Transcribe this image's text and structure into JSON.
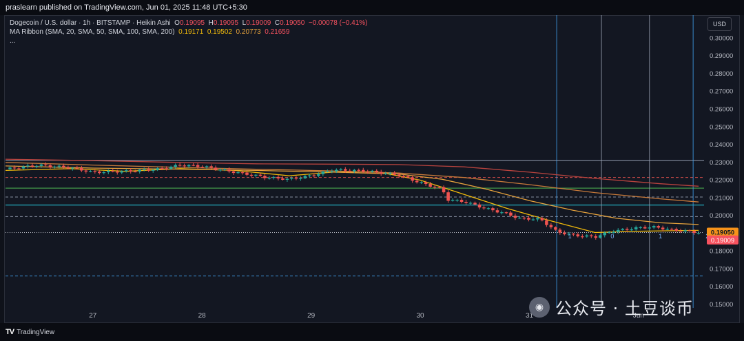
{
  "header": {
    "published": "praslearn published on TradingView.com, Jun 01, 2025 11:48 UTC+5:30"
  },
  "legend": {
    "symbol": "Dogecoin / U.S. dollar · 1h · BITSTAMP · Heikin Ashi",
    "o_label": "O",
    "o": "0.19095",
    "h_label": "H",
    "h": "0.19095",
    "l_label": "L",
    "l": "0.19009",
    "c_label": "C",
    "c": "0.19050",
    "change": "−0.00078 (−0.41%)",
    "ma_name": "MA Ribbon (SMA, 20, SMA, 50, SMA, 100, SMA, 200)",
    "ma1": "0.19171",
    "ma2": "0.19502",
    "ma3": "0.20773",
    "ma4": "0.21659",
    "more": "..."
  },
  "currency": "USD",
  "price_labels": {
    "last": "0.19050",
    "countdown": "41:41",
    "low": "0.19009"
  },
  "footer": {
    "brand": "TradingView"
  },
  "watermark": {
    "text": "公众号 · 土豆谈币"
  },
  "colors": {
    "up": "#26a69a",
    "down": "#ef5350",
    "ma20": "#f0b90b",
    "ma50": "#e6a23c",
    "ma100": "#c87a3a",
    "ma200": "#b8433e",
    "background": "#131722"
  },
  "chart_data": {
    "type": "candlestick",
    "title": "Dogecoin / U.S. dollar · 1h · BITSTAMP · Heikin Ashi",
    "x_labels": [
      "27",
      "28",
      "29",
      "30",
      "31",
      "Jun"
    ],
    "y_ticks": [
      "0.30000",
      "0.29000",
      "0.28000",
      "0.27000",
      "0.26000",
      "0.25000",
      "0.24000",
      "0.23000",
      "0.22000",
      "0.21000",
      "0.20000",
      "0.18000",
      "0.17000",
      "0.16000",
      "0.15000"
    ],
    "ylim": [
      0.148,
      0.306
    ],
    "x_range": [
      26.2,
      32.6
    ],
    "horizontal_levels": [
      {
        "value": 0.2312,
        "style": "solid",
        "color": "#9aa3b5"
      },
      {
        "value": 0.2215,
        "style": "dashed",
        "color": "#ef5350"
      },
      {
        "value": 0.2155,
        "style": "solid",
        "color": "#4caf50"
      },
      {
        "value": 0.2105,
        "style": "dashed",
        "color": "#9aa3b5"
      },
      {
        "value": 0.206,
        "style": "solid",
        "color": "#26c6da"
      },
      {
        "value": 0.1995,
        "style": "dashed",
        "color": "#9aa3b5"
      },
      {
        "value": 0.1905,
        "style": "dotted",
        "color": "#d1d4dc"
      },
      {
        "value": 0.166,
        "style": "dashed",
        "color": "#42a5f5"
      }
    ],
    "vertical_lines": [
      {
        "x": 31.25,
        "color": "#42a5f5"
      },
      {
        "x": 31.66,
        "color": "#9aa3b5"
      },
      {
        "x": 32.1,
        "color": "#9aa3b5"
      },
      {
        "x": 32.5,
        "color": "#42a5f5"
      }
    ],
    "wave_labels": [
      {
        "x": 31.37,
        "y": 0.1872,
        "text": "1"
      },
      {
        "x": 31.76,
        "y": 0.1872,
        "text": "0"
      },
      {
        "x": 32.2,
        "y": 0.1872,
        "text": "1"
      },
      {
        "x": 32.63,
        "y": 0.1872,
        "text": "2"
      }
    ],
    "anchors": [
      [
        26.2,
        0.2262
      ],
      [
        26.5,
        0.2285
      ],
      [
        26.8,
        0.227
      ],
      [
        27.0,
        0.2245
      ],
      [
        27.3,
        0.225
      ],
      [
        27.6,
        0.2262
      ],
      [
        27.8,
        0.2285
      ],
      [
        28.0,
        0.2278
      ],
      [
        28.3,
        0.2245
      ],
      [
        28.6,
        0.2215
      ],
      [
        28.8,
        0.2205
      ],
      [
        29.0,
        0.2225
      ],
      [
        29.2,
        0.2258
      ],
      [
        29.5,
        0.2252
      ],
      [
        29.8,
        0.223
      ],
      [
        30.0,
        0.2185
      ],
      [
        30.2,
        0.215
      ],
      [
        30.25,
        0.209
      ],
      [
        30.4,
        0.208
      ],
      [
        30.6,
        0.204
      ],
      [
        30.8,
        0.201
      ],
      [
        30.9,
        0.1985
      ],
      [
        31.1,
        0.198
      ],
      [
        31.25,
        0.191
      ],
      [
        31.4,
        0.189
      ],
      [
        31.6,
        0.188
      ],
      [
        31.75,
        0.1912
      ],
      [
        32.0,
        0.1932
      ],
      [
        32.15,
        0.1936
      ],
      [
        32.3,
        0.192
      ],
      [
        32.45,
        0.1912
      ],
      [
        32.55,
        0.1905
      ]
    ],
    "series": [
      {
        "name": "SMA 20",
        "color": "#f0b90b",
        "points": [
          [
            26.2,
            0.2255
          ],
          [
            26.8,
            0.2265
          ],
          [
            27.3,
            0.225
          ],
          [
            27.8,
            0.2265
          ],
          [
            28.3,
            0.2255
          ],
          [
            28.8,
            0.2225
          ],
          [
            29.2,
            0.2245
          ],
          [
            29.6,
            0.2248
          ],
          [
            30.0,
            0.22
          ],
          [
            30.4,
            0.212
          ],
          [
            30.8,
            0.204
          ],
          [
            31.2,
            0.197
          ],
          [
            31.6,
            0.1905
          ],
          [
            32.0,
            0.1912
          ],
          [
            32.4,
            0.1916
          ],
          [
            32.55,
            0.1917
          ]
        ]
      },
      {
        "name": "SMA 50",
        "color": "#e6a23c",
        "points": [
          [
            26.2,
            0.228
          ],
          [
            27.0,
            0.2268
          ],
          [
            27.8,
            0.2262
          ],
          [
            28.5,
            0.2255
          ],
          [
            29.2,
            0.2245
          ],
          [
            29.8,
            0.2235
          ],
          [
            30.2,
            0.2205
          ],
          [
            30.6,
            0.215
          ],
          [
            31.0,
            0.2085
          ],
          [
            31.4,
            0.203
          ],
          [
            31.8,
            0.1985
          ],
          [
            32.2,
            0.196
          ],
          [
            32.55,
            0.195
          ]
        ]
      },
      {
        "name": "SMA 100",
        "color": "#c87a3a",
        "points": [
          [
            26.2,
            0.23
          ],
          [
            27.0,
            0.2285
          ],
          [
            27.8,
            0.2272
          ],
          [
            28.5,
            0.2262
          ],
          [
            29.2,
            0.2252
          ],
          [
            29.8,
            0.224
          ],
          [
            30.4,
            0.2215
          ],
          [
            31.0,
            0.2175
          ],
          [
            31.6,
            0.213
          ],
          [
            32.2,
            0.2095
          ],
          [
            32.55,
            0.2077
          ]
        ]
      },
      {
        "name": "SMA 200",
        "color": "#b8433e",
        "points": [
          [
            26.2,
            0.2318
          ],
          [
            27.0,
            0.231
          ],
          [
            27.8,
            0.23
          ],
          [
            28.5,
            0.2292
          ],
          [
            29.2,
            0.229
          ],
          [
            29.8,
            0.2288
          ],
          [
            30.4,
            0.2275
          ],
          [
            31.0,
            0.2245
          ],
          [
            31.6,
            0.221
          ],
          [
            32.2,
            0.218
          ],
          [
            32.55,
            0.2166
          ]
        ]
      }
    ]
  }
}
